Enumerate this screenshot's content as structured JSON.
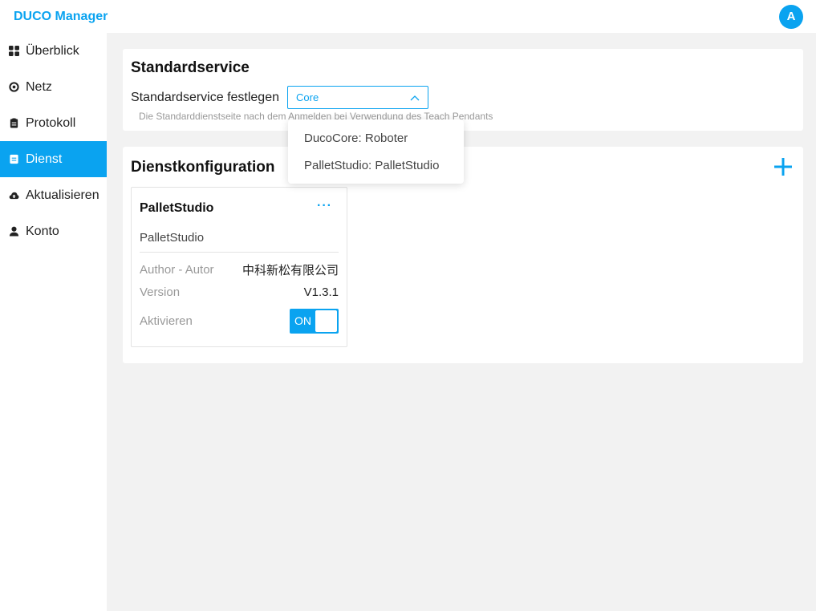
{
  "app": {
    "title": "DUCO Manager",
    "avatar_initial": "A"
  },
  "sidebar": {
    "items": [
      {
        "label": "Überblick",
        "icon": "grid-icon",
        "active": false
      },
      {
        "label": "Netz",
        "icon": "target-icon",
        "active": false
      },
      {
        "label": "Protokoll",
        "icon": "clipboard-icon",
        "active": false
      },
      {
        "label": "Dienst",
        "icon": "document-icon",
        "active": true
      },
      {
        "label": "Aktualisieren",
        "icon": "cloud-upload-icon",
        "active": false
      },
      {
        "label": "Konto",
        "icon": "user-icon",
        "active": false
      }
    ]
  },
  "standard_service": {
    "title": "Standardservice",
    "label": "Standardservice festlegen",
    "selected": "Core",
    "hint": "Die Standarddienstseite nach dem Anmelden bei Verwendung des Teach Pendants",
    "dropdown_options": [
      "DucoCore: Roboter",
      "PalletStudio: PalletStudio"
    ]
  },
  "service_config": {
    "title": "Dienstkonfiguration",
    "card": {
      "name": "PalletStudio",
      "more": "···",
      "description": "PalletStudio",
      "author_label": "Author - Autor",
      "author_value": "中科新松有限公司",
      "version_label": "Version",
      "version_value": "V1.3.1",
      "activate_label": "Aktivieren",
      "toggle_label": "ON"
    }
  },
  "colors": {
    "accent": "#0aa3f0",
    "background": "#f2f2f2"
  }
}
